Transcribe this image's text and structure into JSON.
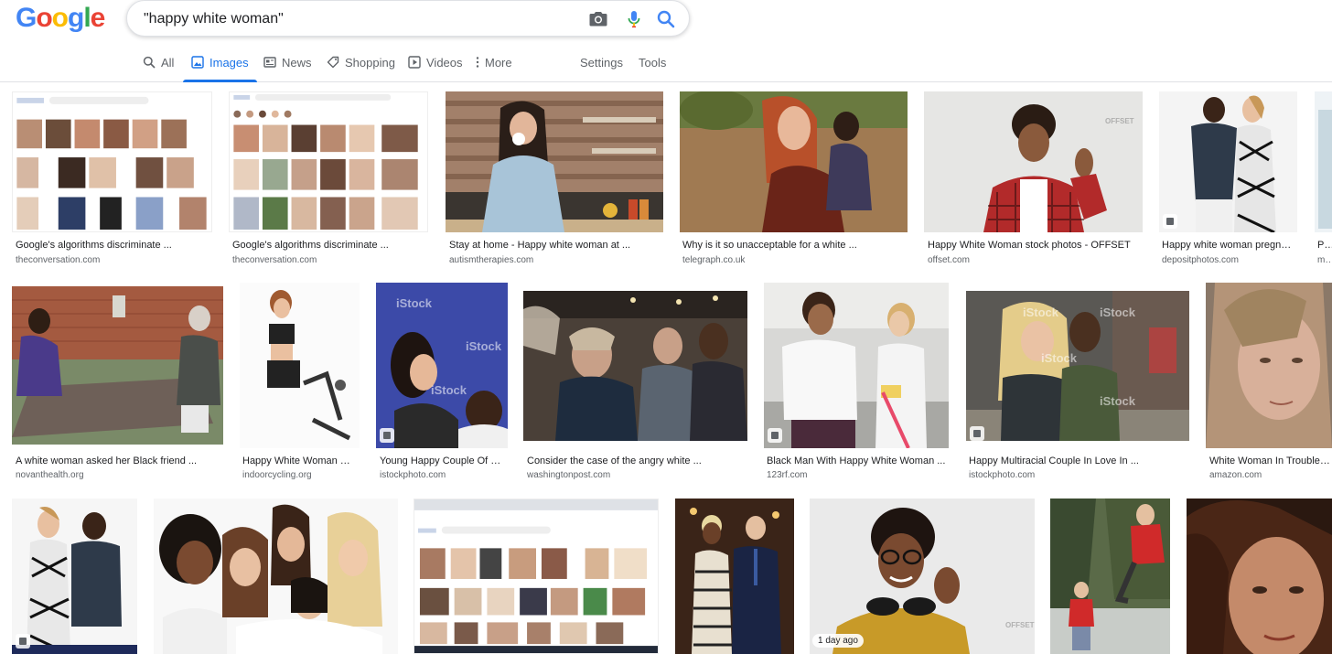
{
  "logo": {
    "letters": [
      "G",
      "o",
      "o",
      "g",
      "l",
      "e"
    ],
    "colors": [
      "#4285f4",
      "#ea4335",
      "#fbbc05",
      "#4285f4",
      "#34a853",
      "#ea4335"
    ]
  },
  "search": {
    "value": "\"happy white woman\""
  },
  "icons": {
    "camera": "camera-icon",
    "mic": "microphone-icon",
    "search": "search-icon"
  },
  "accent": "#1a73e8",
  "tabs": [
    {
      "label": "All",
      "icon": "search-icon"
    },
    {
      "label": "Images",
      "icon": "image-icon"
    },
    {
      "label": "News",
      "icon": "news-icon"
    },
    {
      "label": "Shopping",
      "icon": "tag-icon"
    },
    {
      "label": "Videos",
      "icon": "play-icon"
    },
    {
      "label": "More",
      "icon": "more-vert-icon"
    },
    {
      "label": "Settings"
    },
    {
      "label": "Tools"
    }
  ],
  "results": {
    "row1": [
      {
        "title": "Google's algorithms discriminate ...",
        "source": "theconversation.com"
      },
      {
        "title": "Google's algorithms discriminate ...",
        "source": "theconversation.com"
      },
      {
        "title": "Stay at home - Happy white woman at ...",
        "source": "autismtherapies.com"
      },
      {
        "title": "Why is it so unacceptable for a white ...",
        "source": "telegraph.co.uk"
      },
      {
        "title": "Happy White Woman stock photos - OFFSET",
        "source": "offset.com"
      },
      {
        "title": "Happy white woman pregna...",
        "source": "depositphotos.com"
      },
      {
        "title": "Por",
        "source": "mar"
      }
    ],
    "row2": [
      {
        "title": "A white woman asked her Black friend ...",
        "source": "novanthealth.org"
      },
      {
        "title": "Happy White Woman Ri...",
        "source": "indoorcycling.org"
      },
      {
        "title": "Young Happy Couple Of Bl...",
        "source": "istockphoto.com"
      },
      {
        "title": "Consider the case of the angry white ...",
        "source": "washingtonpost.com"
      },
      {
        "title": "Black Man With Happy White Woman ...",
        "source": "123rf.com"
      },
      {
        "title": "Happy Multiracial Couple In Love In ...",
        "source": "istockphoto.com"
      },
      {
        "title": "White Woman In Trouble by",
        "source": "amazon.com"
      }
    ],
    "row3_badge": "1 day ago"
  },
  "watermarks": {
    "istock": "iStock",
    "offset": "OFFSET"
  }
}
